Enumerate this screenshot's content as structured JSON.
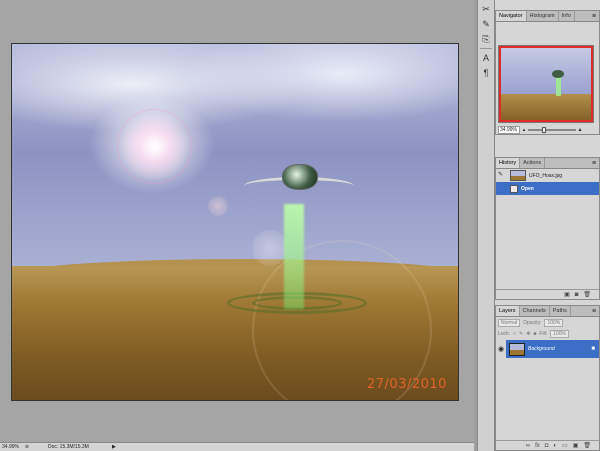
{
  "document": {
    "date_stamp": "27/03/2010"
  },
  "status": {
    "zoom": "34.99%",
    "doc_info": "Doc: 15.3M/15.3M",
    "arrow": "▶"
  },
  "tool_strip": {
    "icons": [
      "scissors-icon",
      "brush-options-icon",
      "clone-source-icon",
      "character-icon",
      "paragraph-icon"
    ]
  },
  "navigator": {
    "tabs": [
      "Navigator",
      "Histogram",
      "Info"
    ],
    "zoom": "34.99%"
  },
  "history": {
    "tabs": [
      "History",
      "Actions"
    ],
    "items": [
      {
        "label": "UFO_Hoax.jpg",
        "type": "snapshot"
      },
      {
        "label": "Open",
        "type": "state",
        "selected": true
      }
    ]
  },
  "layers": {
    "tabs": [
      "Layers",
      "Channels",
      "Paths"
    ],
    "blend_mode": "Normal",
    "opacity_label": "Opacity:",
    "opacity_value": "100%",
    "lock_label": "Lock:",
    "fill_label": "Fill:",
    "fill_value": "100%",
    "rows": [
      {
        "name": "Background",
        "visible": true,
        "locked": true
      }
    ]
  },
  "colors": {
    "selection": "#3c6ec6",
    "date_stamp": "#e06428",
    "navigator_proxy": "#e02b2b"
  }
}
